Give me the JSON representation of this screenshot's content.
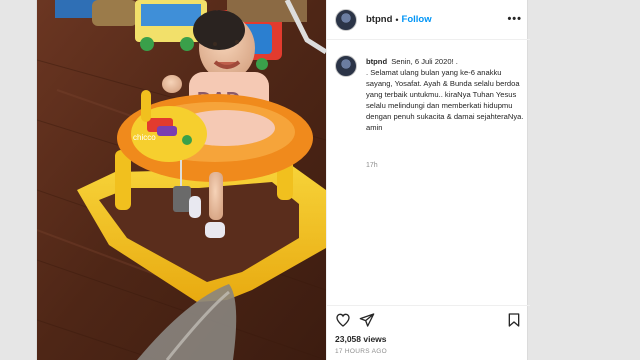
{
  "post": {
    "username": "btpnd",
    "follow_label": "Follow",
    "separator": "•",
    "more_label": "•••",
    "caption": {
      "username": "btpnd",
      "headline": "Senin, 6 Juli 2020! .",
      "body": ". Selamat ulang bulan yang ke-6 anakku sayang, Yosafat. Ayah & Bunda selalu berdoa yang terbaik untukmu.. kiraNya Tuhan Yesus selalu melindungi dan memberkati hidupmu dengan penuh sukacita & damai sejahteraNya. amin",
      "time": "17h"
    },
    "likes": "23,058 views",
    "time_ago": "17 HOURS AGO",
    "icons": {
      "like": "heart-icon",
      "share": "paper-plane-icon",
      "save": "bookmark-icon",
      "more": "more-dots-icon"
    },
    "colors": {
      "follow": "#0095f6",
      "text": "#262626",
      "muted": "#8e8e8e",
      "walker_seat": "#f08a1c",
      "walker_base": "#f2c21a",
      "floor": "#5a2d1c"
    }
  }
}
